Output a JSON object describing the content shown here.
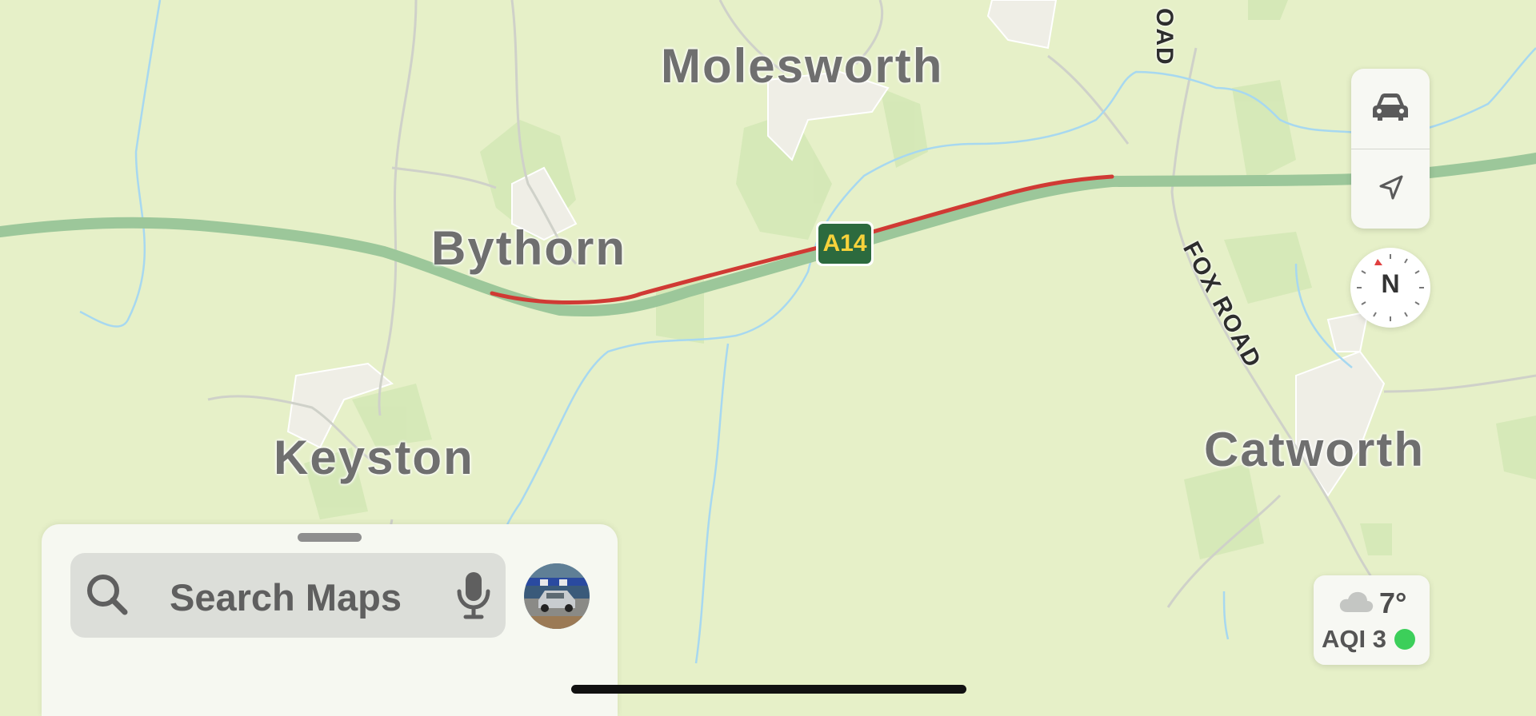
{
  "map": {
    "places": [
      "Molesworth",
      "Bythorn",
      "Keyston",
      "Catworth"
    ],
    "roads": {
      "shield": "A14",
      "fox_road": "FOX ROAD",
      "top_road_fragment": "OAD"
    },
    "colors": {
      "land": "#e6f0c8",
      "major_road": "#9cc79a",
      "traffic": "#d03a34",
      "water": "#a7d8f0",
      "village": "#efeee6"
    }
  },
  "controls": {
    "drive_icon": "car-icon",
    "location_icon": "location-arrow-icon",
    "compass_label": "N"
  },
  "weather": {
    "icon": "cloud-icon",
    "temp": "7°",
    "aqi": "AQI 3",
    "aqi_color": "#3ccf5a"
  },
  "search": {
    "placeholder": "Search Maps",
    "icon": "search-icon",
    "mic_icon": "microphone-icon"
  },
  "profile": {
    "avatar": "avatar"
  }
}
